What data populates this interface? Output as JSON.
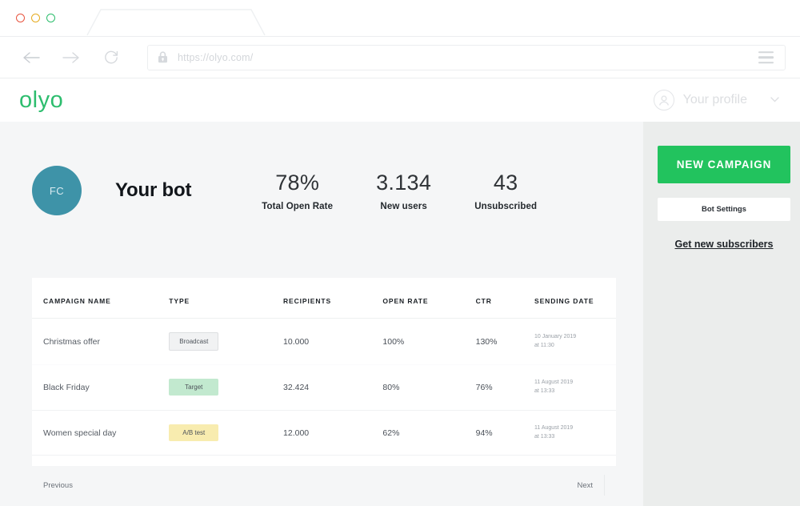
{
  "browser": {
    "tab_title": "",
    "url": "https://olyo.com/",
    "back_icon": "arrow-left-icon",
    "forward_icon": "arrow-right-icon",
    "reload_icon": "reload-icon",
    "lock_icon": "lock-icon",
    "menu_icon": "hamburger-icon"
  },
  "header": {
    "logo": "olyo",
    "logo_color": "#2dbd6e",
    "profile_label": "Your profile",
    "profile_icon": "user-avatar-icon",
    "chevron": "∨"
  },
  "summary": {
    "avatar_initials": "FC",
    "avatar_color": "#3e93a8",
    "bot_name": "Your bot",
    "stats": [
      {
        "value": "78%",
        "label": "Total Open Rate"
      },
      {
        "value": "3.134",
        "label": "New users"
      },
      {
        "value": "43",
        "label": "Unsubscribed"
      }
    ]
  },
  "table": {
    "columns": [
      "CAMPAIGN NAME",
      "TYPE",
      "RECIPIENTS",
      "OPEN RATE",
      "CTR",
      "SENDING DATE"
    ],
    "rows": [
      {
        "name": "Christmas offer",
        "type": "Broadcast",
        "type_style": "broadcast",
        "recipients": "10.000",
        "open_rate": "100%",
        "ctr": "130%",
        "date_day": "10 January 2019",
        "date_time": "at 11:30"
      },
      {
        "name": "Black Friday",
        "type": "Target",
        "type_style": "target",
        "recipients": "32.424",
        "open_rate": "80%",
        "ctr": "76%",
        "date_day": "11 August 2019",
        "date_time": "at 13:33"
      },
      {
        "name": "Women special day",
        "type": "A/B test",
        "type_style": "ab",
        "recipients": "12.000",
        "open_rate": "62%",
        "ctr": "94%",
        "date_day": "11 August 2019",
        "date_time": "at 13:33"
      }
    ],
    "pagination": {
      "previous": "Previous",
      "next": "Next"
    }
  },
  "sidebar": {
    "new_campaign": "NEW CAMPAIGN",
    "new_campaign_color": "#22c35e",
    "bot_settings": "Bot Settings",
    "get_subscribers": "Get new subscribers"
  }
}
